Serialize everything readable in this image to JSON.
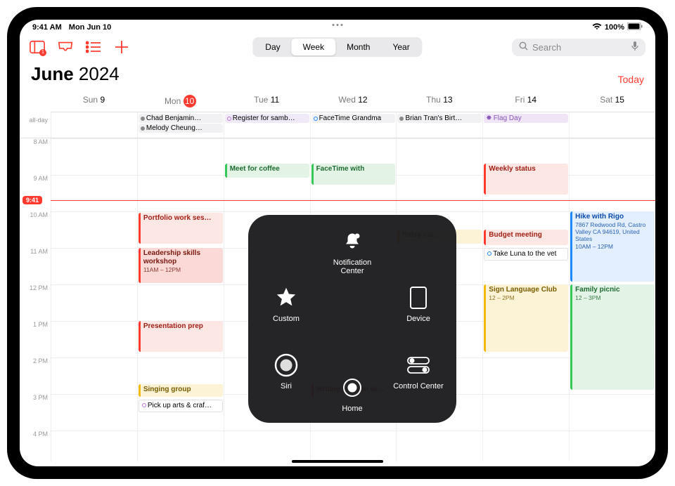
{
  "status": {
    "time": "9:41 AM",
    "date": "Mon Jun 10",
    "battery": "100%"
  },
  "toolbar": {
    "badge": "1",
    "views": {
      "day": "Day",
      "week": "Week",
      "month": "Month",
      "year": "Year"
    },
    "search_placeholder": "Search"
  },
  "header": {
    "month": "June",
    "year": "2024",
    "today": "Today"
  },
  "days": [
    {
      "short": "Sun",
      "num": "9"
    },
    {
      "short": "Mon",
      "num": "10"
    },
    {
      "short": "Tue",
      "num": "11"
    },
    {
      "short": "Wed",
      "num": "12"
    },
    {
      "short": "Thu",
      "num": "13"
    },
    {
      "short": "Fri",
      "num": "14"
    },
    {
      "short": "Sat",
      "num": "15"
    }
  ],
  "allday_label": "all-day",
  "allday": {
    "mon": [
      {
        "label": "Chad Benjamin…"
      },
      {
        "label": "Melody Cheung…"
      }
    ],
    "tue": {
      "label": "Register for samb…"
    },
    "wed": {
      "label": "FaceTime Grandma"
    },
    "thu": {
      "label": "Brian Tran's Birt…"
    },
    "fri": {
      "label": "Flag Day"
    }
  },
  "hours": [
    "8 AM",
    "9 AM",
    "10 AM",
    "11 AM",
    "12 PM",
    "1 PM",
    "2 PM",
    "3 PM",
    "4 PM"
  ],
  "now": "9:41",
  "events": {
    "mon": {
      "portfolio": "Portfolio work ses…",
      "leadership": "Leadership skills workshop",
      "leadership_time": "11AM – 12PM",
      "presentation": "Presentation prep",
      "singing": "Singing group",
      "pickup": "Pick up arts & craf…"
    },
    "tue": {
      "coffee": "Meet for coffee"
    },
    "wed": {
      "facetime": "FaceTime with",
      "writing": "Writing session wi…"
    },
    "thu": {
      "bday": "thday car…"
    },
    "fri": {
      "weekly": "Weekly status",
      "budget": "Budget meeting",
      "luna": "Take Luna to the vet",
      "signlang": "Sign Language Club",
      "signlang_time": "12 – 2PM"
    },
    "sat": {
      "hike": "Hike with Rigo",
      "hike_loc": "7867 Redwood Rd, Castro Valley CA 94619, United States",
      "hike_time": "10AM – 12PM",
      "picnic": "Family picnic",
      "picnic_time": "12 – 3PM"
    }
  },
  "atouch": {
    "notification": "Notification Center",
    "custom": "Custom",
    "device": "Device",
    "siri": "Siri",
    "control": "Control Center",
    "home": "Home"
  }
}
